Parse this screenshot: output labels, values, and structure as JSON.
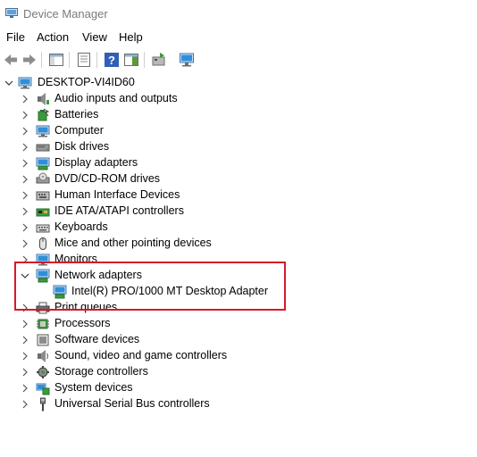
{
  "window": {
    "title": "Device Manager",
    "icon": "device-manager-icon"
  },
  "menu": [
    "File",
    "Action",
    "View",
    "Help"
  ],
  "toolbar": {
    "buttons": [
      "back-arrow-icon",
      "forward-arrow-icon",
      "show-hide-console-tree-icon",
      "properties-icon",
      "help-icon",
      "action-pane-icon",
      "update-driver-icon",
      "scan-hardware-icon"
    ]
  },
  "tree": {
    "root": "DESKTOP-VI4ID60",
    "categories": [
      "Audio inputs and outputs",
      "Batteries",
      "Computer",
      "Disk drives",
      "Display adapters",
      "DVD/CD-ROM drives",
      "Human Interface Devices",
      "IDE ATA/ATAPI controllers",
      "Keyboards",
      "Mice and other pointing devices",
      "Monitors",
      "Network adapters",
      "Print queues",
      "Processors",
      "Software devices",
      "Sound, video and game controllers",
      "Storage controllers",
      "System devices",
      "Universal Serial Bus controllers"
    ],
    "network_child": "Intel(R) PRO/1000 MT Desktop Adapter"
  },
  "colors": {
    "highlight": "#d6182a",
    "title_text": "#7a7a7a",
    "icon_blue": "#1e78d2"
  }
}
